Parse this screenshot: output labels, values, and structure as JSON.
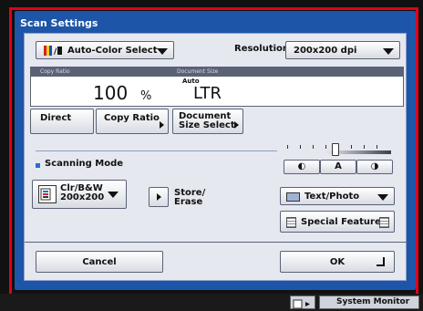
{
  "window": {
    "title": "Scan Settings"
  },
  "colors": {
    "accent_blue": "#1d55a8",
    "border_red": "#e0001a",
    "bullet_blue": "#2c6cd1"
  },
  "top": {
    "color_mode": "Auto-Color Select",
    "resolution_label": "Resolution:",
    "resolution_value": "200x200 dpi"
  },
  "ratio_display": {
    "copy_ratio_caption": "Copy Ratio",
    "document_size_caption": "Document Size",
    "ratio_value": "100",
    "ratio_unit": "%",
    "auto_label": "Auto",
    "document_size_value": "LTR"
  },
  "buttons": {
    "direct": "Direct",
    "copy_ratio": "Copy Ratio",
    "document_size_select": "Document\nSize Select",
    "cancel": "Cancel",
    "ok": "OK",
    "store_erase": "Store/\nErase",
    "special_features": "Special Features"
  },
  "density": {
    "lighter_icon": "◐",
    "auto": "A",
    "darker_icon": "◑",
    "level_fraction": 0.48
  },
  "scanning_mode": {
    "title": "Scanning Mode",
    "mode_value": "Clr/B&W\n200x200",
    "original_type": "Text/Photo"
  },
  "footer": {
    "system_monitor": "System Monitor"
  }
}
